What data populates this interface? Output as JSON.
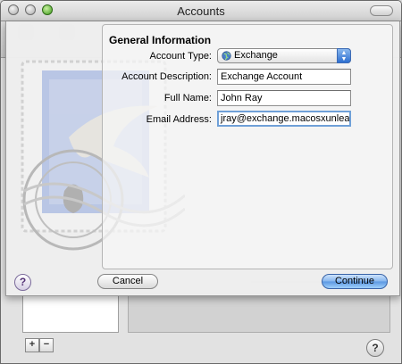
{
  "window": {
    "title": "Accounts"
  },
  "sheet": {
    "section_title": "General Information",
    "fields": {
      "account_type": {
        "label": "Account Type:",
        "value": "Exchange"
      },
      "account_description": {
        "label": "Account Description:",
        "value": "Exchange Account"
      },
      "full_name": {
        "label": "Full Name:",
        "value": "John Ray"
      },
      "email_address": {
        "label": "Email Address:",
        "value": "jray@exchange.macosxunleasl"
      }
    },
    "buttons": {
      "help": "?",
      "cancel": "Cancel",
      "continue": "Continue"
    }
  },
  "background": {
    "add_label": "+",
    "remove_label": "−",
    "help": "?"
  },
  "icons": {
    "account_type": "globe-icon",
    "popup": "popup-arrows-icon",
    "mail_stamp": "mail-stamp-icon"
  },
  "colors": {
    "accent": "#5b97e2",
    "focus_ring": "#6fa0d8"
  }
}
